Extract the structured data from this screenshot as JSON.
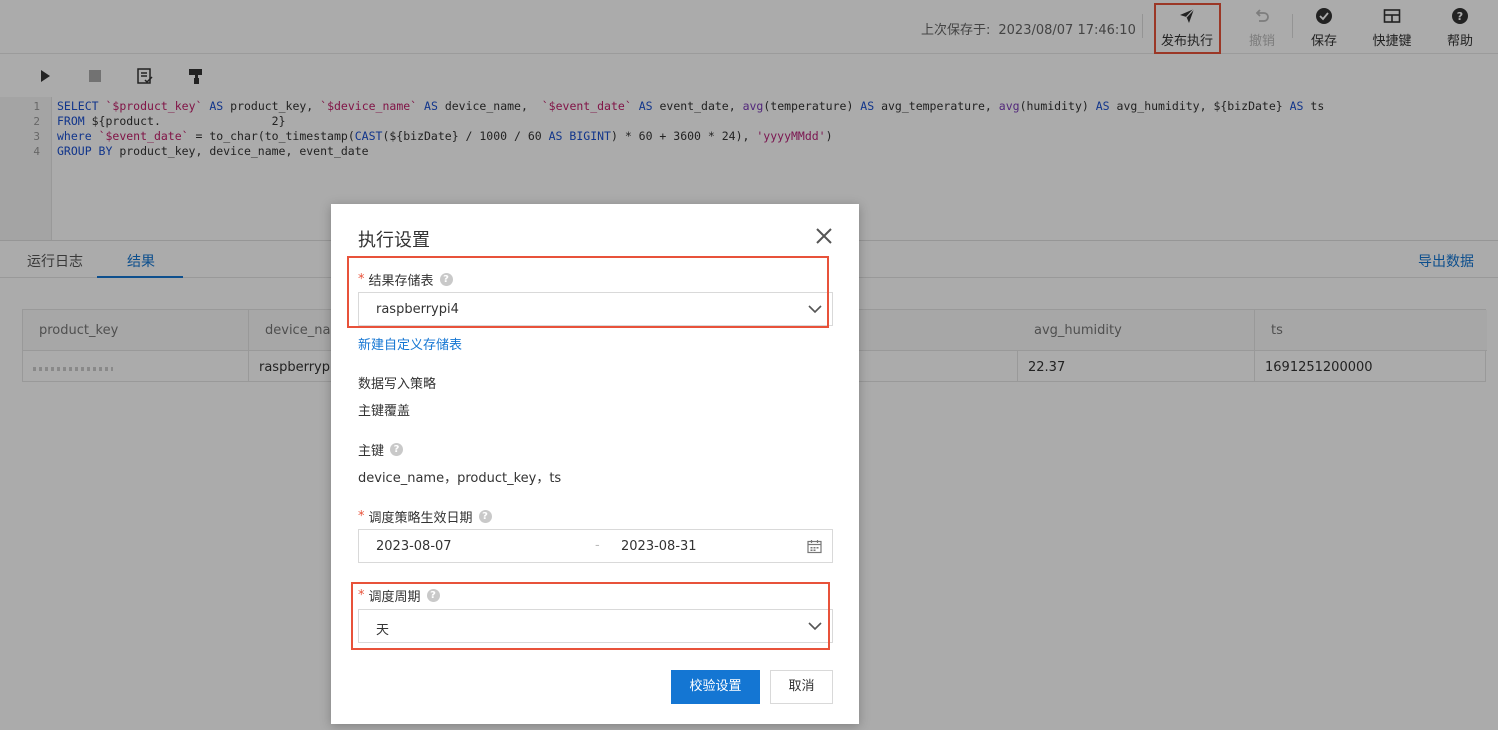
{
  "topbar": {
    "saved_label": "上次保存于:",
    "saved_time": "2023/08/07 17:46:10",
    "buttons": {
      "publish": "发布执行",
      "undo": "撤销",
      "save": "保存",
      "shortcuts": "快捷键",
      "help": "帮助"
    }
  },
  "editor": {
    "toolbar_icons": [
      "run-icon",
      "stop-icon",
      "format-icon",
      "format-painter-icon"
    ],
    "line_numbers": [
      "1",
      "2",
      "3",
      "4"
    ],
    "lines": {
      "l1": {
        "a": "SELECT",
        "b": " ",
        "c": "`$product_key`",
        "d": " ",
        "e": "AS",
        "f": " product_key, ",
        "g": "`$device_name`",
        "h": " ",
        "i": "AS",
        "j": " device_name,  ",
        "k": "`$event_date`",
        "l": " ",
        "m": "AS",
        "n": " event_date, ",
        "o": "avg",
        "p": "(temperature) ",
        "q": "AS",
        "r": " avg_temperature, ",
        "s": "avg",
        "t": "(humidity) ",
        "u": "AS",
        "v": " avg_humidity, ${bizDate} ",
        "w": "AS",
        "x": " ts"
      },
      "l2": {
        "a": "FROM",
        "b": " ${product.",
        "c": "                ",
        "d": "2}"
      },
      "l3": {
        "a": "where",
        "b": " ",
        "c": "`$event_date`",
        "d": " = to_char(to_timestamp(",
        "e": "CAST",
        "f": "(${bizDate} / 1000 / 60 ",
        "g": "AS",
        "h": " ",
        "i": "BIGINT",
        "j": ") * 60 + 3600 * 24), ",
        "k": "'yyyyMMdd'",
        "l": ")"
      },
      "l4": {
        "a": "GROUP BY",
        "b": " product_key, device_name, event_date"
      }
    }
  },
  "results": {
    "tabs": [
      "运行日志",
      "结果"
    ],
    "active_tab": "结果",
    "export_label": "导出数据",
    "columns": [
      "product_key",
      "device_nam",
      "avg_humidity",
      "ts"
    ],
    "row": {
      "product_key": "",
      "device_name": "raspberrypi4",
      "avg_humidity": "22.37",
      "ts": "1691251200000"
    }
  },
  "modal": {
    "title": "执行设置",
    "result_table_label": "结果存储表",
    "result_table_value": "raspberrypi4",
    "new_table_link": "新建自定义存储表",
    "write_policy_label": "数据写入策略",
    "write_policy_value": "主键覆盖",
    "primary_key_label": "主键",
    "primary_key_value": "device_name，product_key，ts",
    "effective_date_label": "调度策略生效日期",
    "date_start": "2023-08-07",
    "date_separator": "-",
    "date_end": "2023-08-31",
    "cycle_label": "调度周期",
    "cycle_value": "天",
    "confirm_button": "校验设置",
    "cancel_button": "取消",
    "required_mark": "*",
    "help_mark": "?"
  },
  "colors": {
    "accent": "#1476d3",
    "highlight": "#e8523a",
    "keyword": "#1a4fd0",
    "identifier": "#c0206b"
  }
}
